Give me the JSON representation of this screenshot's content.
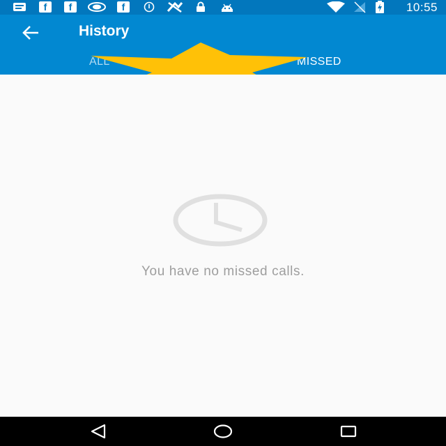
{
  "status_bar": {
    "time": "10:55",
    "fb_glyph": "f",
    "icons": [
      "message-icon",
      "facebook-icon",
      "facebook-icon",
      "nvidia-icon",
      "facebook-icon",
      "data-saver-icon",
      "no-signal-icon",
      "lock-icon",
      "android-icon",
      "wifi-icon",
      "no-sim-icon",
      "battery-charging-icon"
    ]
  },
  "app_bar": {
    "title": "History",
    "back_icon": "arrow-back-icon",
    "tabs": [
      {
        "label": "ALL",
        "selected": false
      },
      {
        "label": "MISSED",
        "selected": true
      }
    ]
  },
  "overlay": {
    "icon": "star-icon",
    "color": "#ffc107"
  },
  "empty_state": {
    "icon": "clock-icon",
    "message": "You have no missed calls."
  },
  "nav_bar": {
    "buttons": [
      "back-triangle-icon",
      "home-circle-icon",
      "recents-square-icon"
    ]
  },
  "colors": {
    "status_bar": "#0277bd",
    "app_bar": "#0288d1",
    "background": "#fafafa",
    "empty_text": "#9e9e9e"
  }
}
